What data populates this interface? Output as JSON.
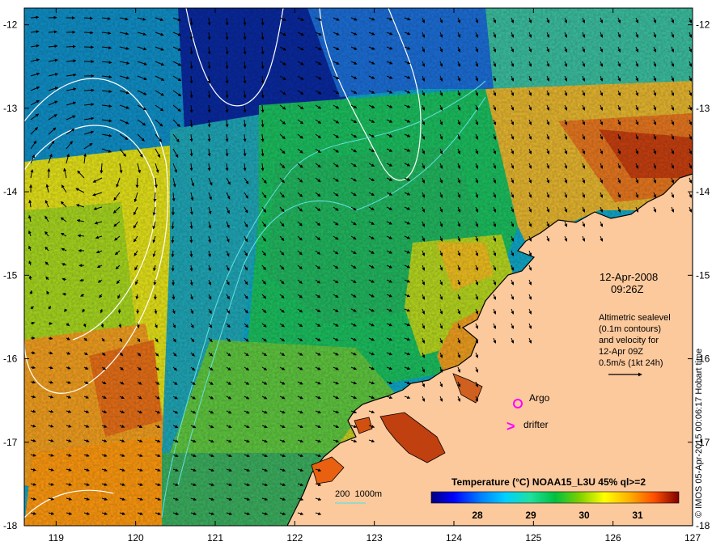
{
  "map": {
    "date_line1": "12-Apr-2008",
    "date_line2": "09:26Z",
    "altimetry_lines": [
      "Altimetric sealevel",
      "(0.1m contours)",
      "and velocity for",
      "12-Apr 09Z",
      "0.5m/s (1kt 24h)"
    ],
    "legend_argo": "Argo",
    "legend_drifter": "drifter",
    "depth_label": "200  1000m",
    "colorbar_title": "Temperature (°C) NOAA15_L3U 45% ql>=2",
    "colorbar_ticks": [
      "28",
      "29",
      "30",
      "31"
    ],
    "credit": "© IMOS 05-Apr-2015 00:06:17 Hobart time",
    "lat_ticks": [
      "-12",
      "-13",
      "-14",
      "-15",
      "-16",
      "-17",
      "-18"
    ],
    "lon_ticks": [
      "119",
      "120",
      "121",
      "122",
      "123",
      "124",
      "125",
      "126",
      "127"
    ],
    "lon_range": [
      118.6,
      127
    ],
    "lat_range": [
      -18,
      -11.8
    ],
    "colors": {
      "land": "#fcc99c",
      "coast": "#000000",
      "argo": "#ff00ff",
      "drifter": "#ff00ff",
      "contour": "#ffffff",
      "isobath": "#66e0e0",
      "colorbar": [
        "#00007f",
        "#0000ff",
        "#0080ff",
        "#00d0ff",
        "#20e0a0",
        "#00c040",
        "#80d000",
        "#ffff00",
        "#ffb000",
        "#ff6000",
        "#c00000",
        "#800000"
      ]
    }
  }
}
